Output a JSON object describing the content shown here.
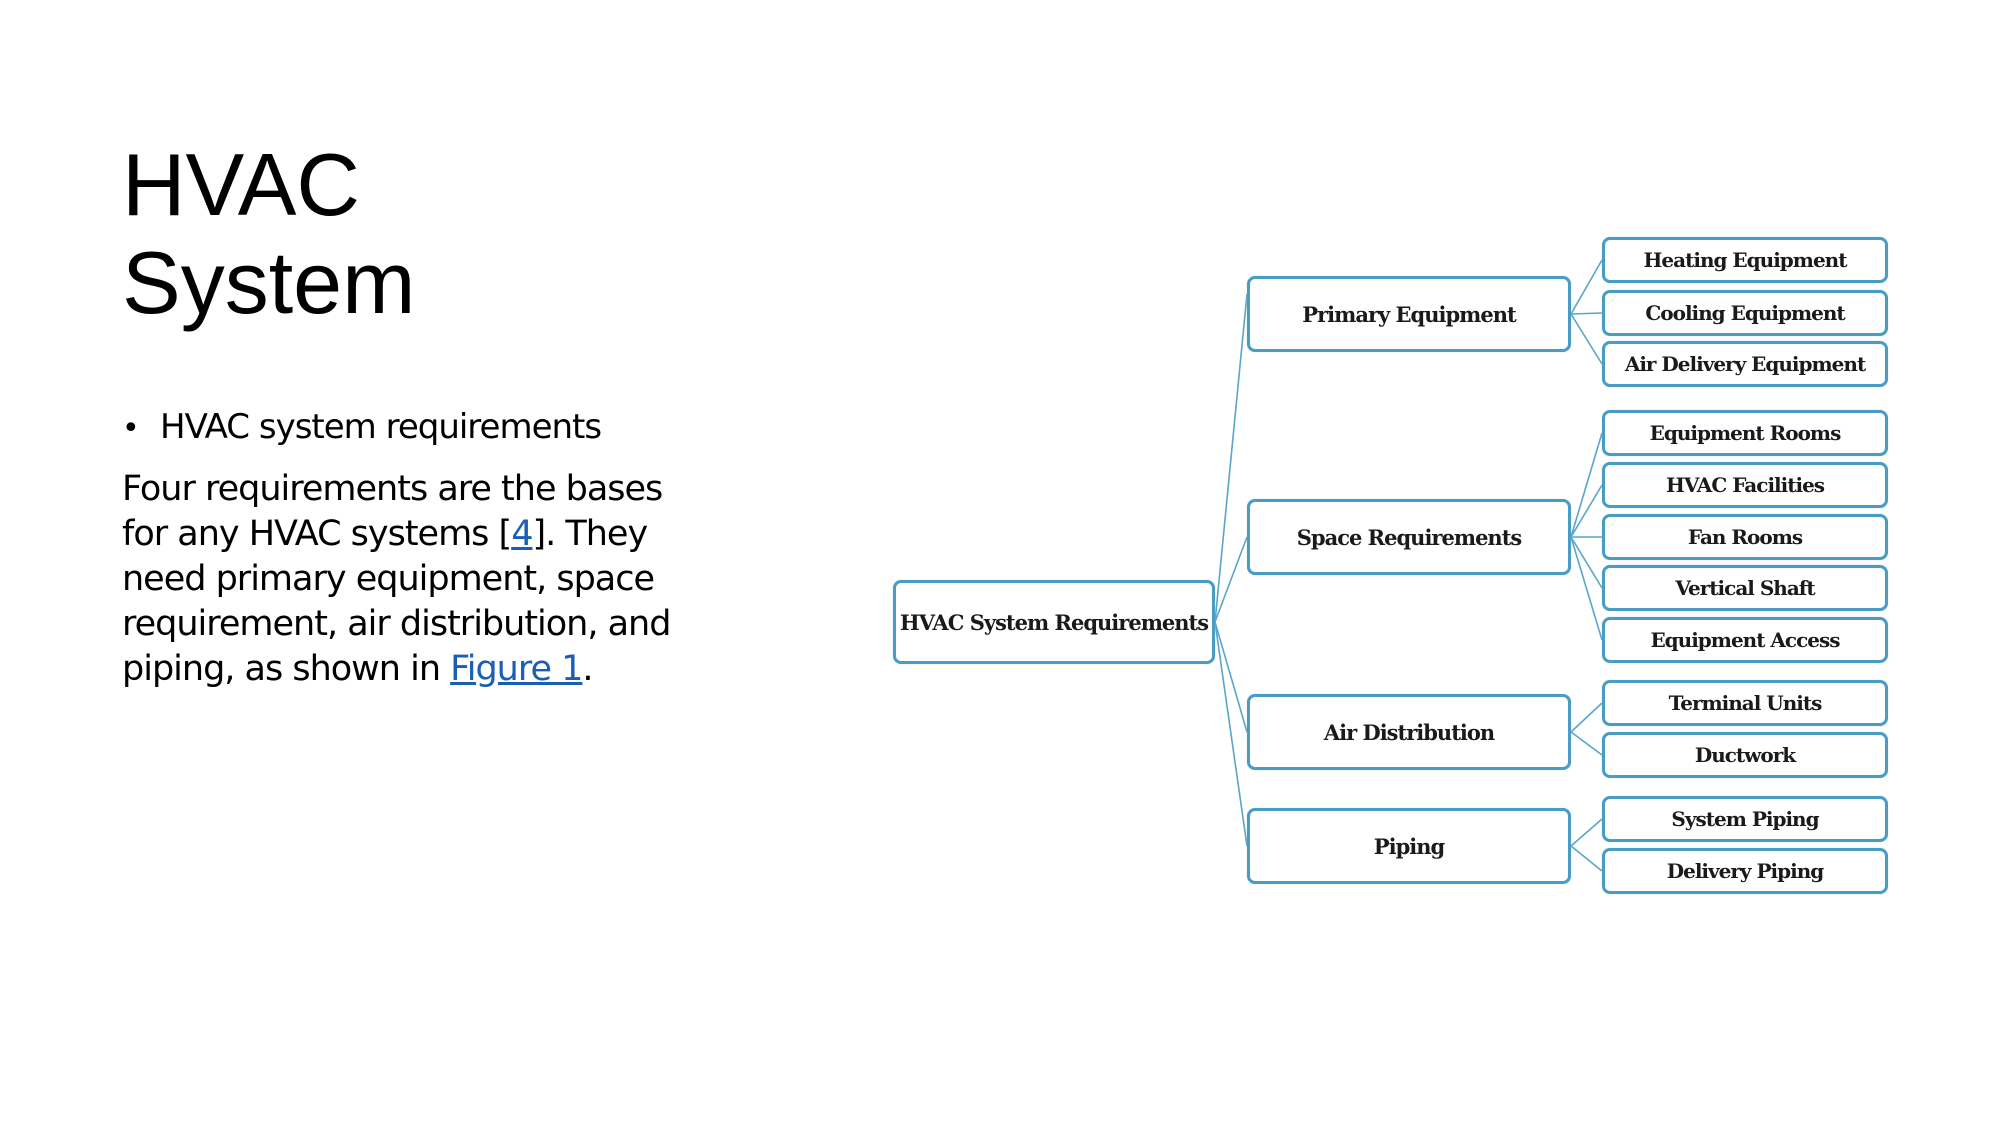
{
  "slide": {
    "title_lines": [
      "HVAC",
      "System"
    ],
    "bullet": "HVAC system requirements",
    "paragraph": {
      "part1": "Four requirements are the bases for any HVAC systems [",
      "ref_link": "4",
      "part2": "]. They need primary equipment, space requirement, air distribution, and piping, as shown in ",
      "figure_link": "Figure 1",
      "part3": "."
    }
  },
  "diagram": {
    "root": "HVAC System Requirements",
    "branches": [
      {
        "label": "Primary Equipment",
        "children": [
          "Heating Equipment",
          "Cooling Equipment",
          "Air Delivery Equipment"
        ]
      },
      {
        "label": "Space Requirements",
        "children": [
          "Equipment Rooms",
          "HVAC Facilities",
          "Fan Rooms",
          "Vertical Shaft",
          "Equipment Access"
        ]
      },
      {
        "label": "Air Distribution",
        "children": [
          "Terminal Units",
          "Ductwork"
        ]
      },
      {
        "label": "Piping",
        "children": [
          "System Piping",
          "Delivery Piping"
        ]
      }
    ],
    "colors": {
      "border": "#4a9cc4",
      "connector": "#5aa5cc",
      "link": "#1a5fb4"
    }
  }
}
